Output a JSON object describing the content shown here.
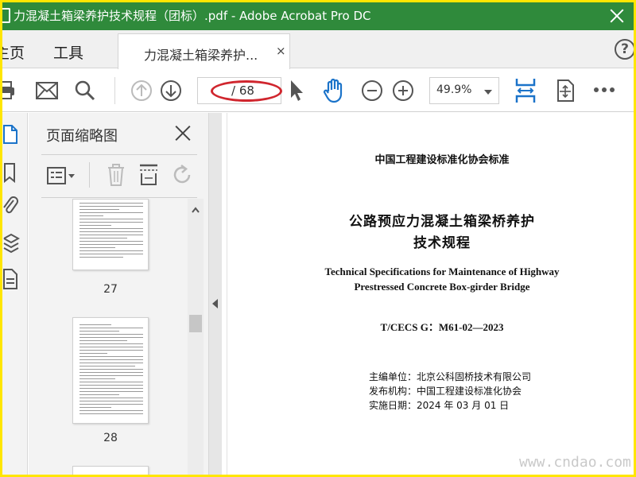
{
  "window": {
    "title": "力混凝土箱梁养护技术规程（团标）.pdf - Adobe Acrobat Pro DC"
  },
  "tabs": {
    "home": "主页",
    "tools": "工具",
    "document": "力混凝土箱梁养护...",
    "doc_close": "×",
    "help": "?"
  },
  "toolbar": {
    "page_current": "",
    "page_total": "/ 68",
    "zoom": "49.9%"
  },
  "thumbnail_panel": {
    "title": "页面缩略图",
    "thumbnails": [
      {
        "page": "27"
      },
      {
        "page": "28"
      }
    ]
  },
  "document": {
    "issuer_header": "中国工程建设标准化协会标准",
    "title_line1": "公路预应力混凝土箱梁桥养护",
    "title_line2": "技术规程",
    "title_en_line1": "Technical Specifications for Maintenance of Highway",
    "title_en_line2": "Prestressed Concrete Box-girder Bridge",
    "standard_code": "T/CECS G：M61-02—2023",
    "chief_editor": "主编单位：北京公科固桥技术有限公司",
    "publisher": "发布机构：中国工程建设标准化协会",
    "effective_date": "实施日期：2024 年 03 月 01 日"
  },
  "watermark": "www.cndao.com",
  "colors": {
    "titlebar": "#2f8a3b",
    "border": "#ffe600",
    "annotation_ring": "#d0262e",
    "accent_blue": "#1b73c9"
  }
}
